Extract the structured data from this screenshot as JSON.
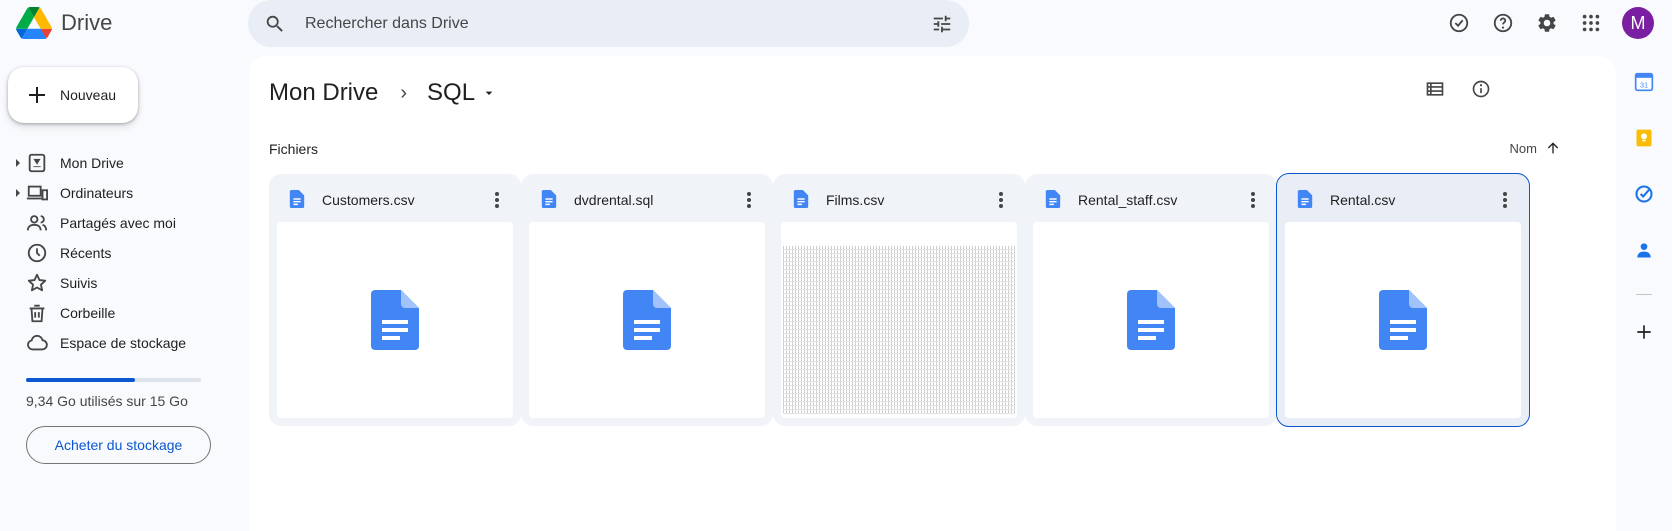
{
  "app": {
    "brand": "Drive"
  },
  "search": {
    "placeholder": "Rechercher dans Drive"
  },
  "user": {
    "avatar_letter": "M",
    "avatar_color": "#7b1fa2"
  },
  "sidebar": {
    "new_label": "Nouveau",
    "items": [
      {
        "label": "Mon Drive",
        "icon": "my-drive-icon",
        "expandable": true
      },
      {
        "label": "Ordinateurs",
        "icon": "computers-icon",
        "expandable": true
      },
      {
        "label": "Partagés avec moi",
        "icon": "shared-icon",
        "expandable": false
      },
      {
        "label": "Récents",
        "icon": "clock-icon",
        "expandable": false
      },
      {
        "label": "Suivis",
        "icon": "star-icon",
        "expandable": false
      },
      {
        "label": "Corbeille",
        "icon": "trash-icon",
        "expandable": false
      },
      {
        "label": "Espace de stockage",
        "icon": "cloud-icon",
        "expandable": false
      }
    ],
    "storage": {
      "used_text": "9,34 Go utilisés sur 15 Go",
      "used_fraction": 0.62
    },
    "buy_label": "Acheter du stockage"
  },
  "breadcrumb": {
    "root": "Mon Drive",
    "separator": "›",
    "current": "SQL"
  },
  "files_section": {
    "title": "Fichiers",
    "sort_label": "Nom",
    "files": [
      {
        "name": "Customers.csv",
        "preview": "doc-icon",
        "selected": false
      },
      {
        "name": "dvdrental.sql",
        "preview": "doc-icon",
        "selected": false
      },
      {
        "name": "Films.csv",
        "preview": "spreadsheet-thumbnail",
        "selected": false
      },
      {
        "name": "Rental_staff.csv",
        "preview": "doc-icon",
        "selected": false
      },
      {
        "name": "Rental.csv",
        "preview": "doc-icon",
        "selected": true
      }
    ]
  },
  "colors": {
    "accent": "#0b57d0",
    "doc_blue": "#4285f4",
    "panel_bg": "#f8fafd"
  }
}
